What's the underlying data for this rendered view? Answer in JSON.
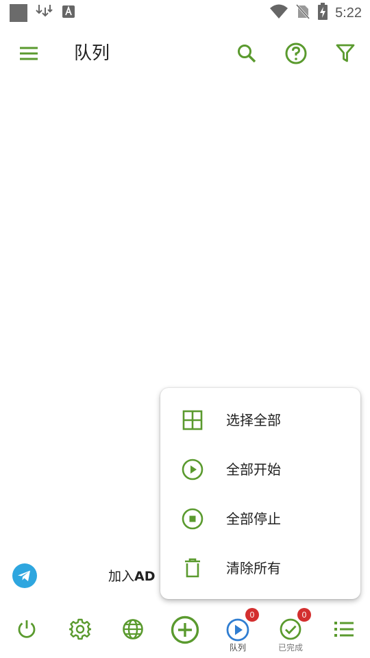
{
  "status_bar": {
    "time": "5:22",
    "icons": [
      "notification-square-icon",
      "download-icon",
      "font-icon",
      "wifi-icon",
      "no-sim-icon",
      "battery-charging-icon"
    ]
  },
  "app_bar": {
    "title": "队列",
    "icons": [
      "menu-icon",
      "search-icon",
      "help-icon",
      "filter-icon"
    ]
  },
  "popup_menu": {
    "items": [
      {
        "label": "选择全部",
        "icon": "select-all-grid-icon"
      },
      {
        "label": "全部开始",
        "icon": "play-circle-icon"
      },
      {
        "label": "全部停止",
        "icon": "stop-circle-icon"
      },
      {
        "label": "清除所有",
        "icon": "trash-icon"
      }
    ]
  },
  "telegram": {
    "join_prefix": "加入",
    "join_bold": "AD"
  },
  "bottom_nav": {
    "items": [
      {
        "name": "power",
        "label": ""
      },
      {
        "name": "settings",
        "label": ""
      },
      {
        "name": "browser",
        "label": ""
      },
      {
        "name": "add",
        "label": ""
      },
      {
        "name": "queue",
        "label": "队列",
        "badge": "0"
      },
      {
        "name": "completed",
        "label": "已完成",
        "badge": "0"
      },
      {
        "name": "list",
        "label": ""
      }
    ]
  },
  "colors": {
    "accent_green": "#5a9a2e",
    "active_blue": "#2f7dd1",
    "badge_red": "#d32f2f",
    "telegram_blue": "#2ea6df"
  }
}
